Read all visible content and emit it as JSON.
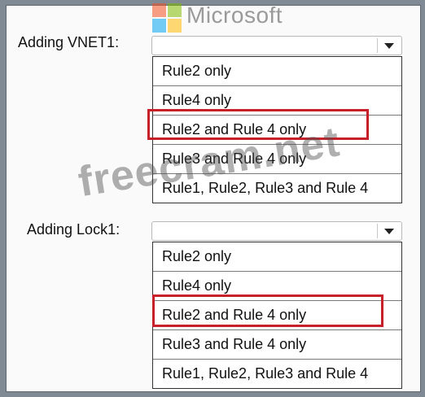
{
  "logo": {
    "text": "Microsoft",
    "colors": [
      "#f25022",
      "#7fba00",
      "#00a4ef",
      "#ffb900"
    ]
  },
  "watermark": {
    "text": "freecram.net"
  },
  "sections": [
    {
      "label": "Adding VNET1:",
      "selected": "",
      "options": [
        "Rule2 only",
        "Rule4 only",
        "Rule2 and Rule 4 only",
        "Rule3 and Rule 4 only",
        "Rule1, Rule2, Rule3 and Rule 4"
      ],
      "highlighted_option": "Rule2 and Rule 4 only"
    },
    {
      "label": "Adding Lock1:",
      "selected": "",
      "options": [
        "Rule2 only",
        "Rule4 only",
        "Rule2 and Rule 4 only",
        "Rule3 and Rule 4 only",
        "Rule1, Rule2, Rule3 and Rule 4"
      ],
      "highlighted_option": "Rule2 and Rule 4 only"
    }
  ],
  "colors": {
    "highlight": "#c8202a",
    "background": "#7f8a94"
  }
}
